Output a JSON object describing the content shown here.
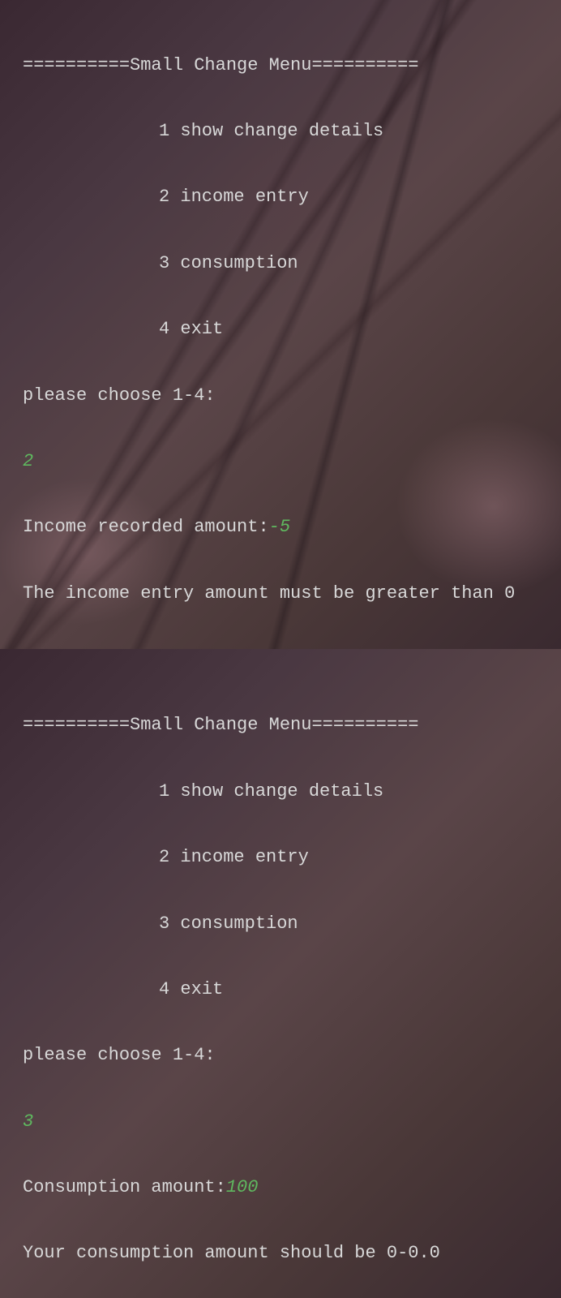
{
  "menu1": {
    "header": "==========Small Change Menu==========",
    "opt1": "1 show change details",
    "opt2": "2 income entry",
    "opt3": "3 consumption",
    "opt4": "4 exit",
    "prompt": "please choose 1-4:",
    "choice": "2",
    "income_prompt": "Income recorded amount:",
    "income_val": "-5",
    "income_err": "The income entry amount must be greater than 0"
  },
  "menu2": {
    "header": "==========Small Change Menu==========",
    "opt1": "1 show change details",
    "opt2": "2 income entry",
    "opt3": "3 consumption",
    "opt4": "4 exit",
    "prompt": "please choose 1-4:",
    "choice": "3",
    "cons_prompt": "Consumption amount:",
    "cons_val": "100",
    "cons_err": "Your consumption amount should be 0-0.0"
  }
}
